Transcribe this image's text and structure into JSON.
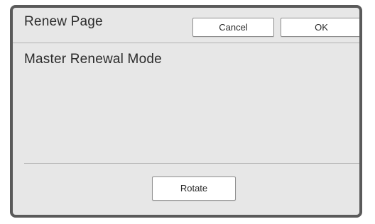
{
  "dialog": {
    "title": "Renew Page",
    "cancel_label": "Cancel",
    "ok_label": "OK",
    "mode_label": "Master Renewal Mode",
    "rotate_label": "Rotate"
  }
}
